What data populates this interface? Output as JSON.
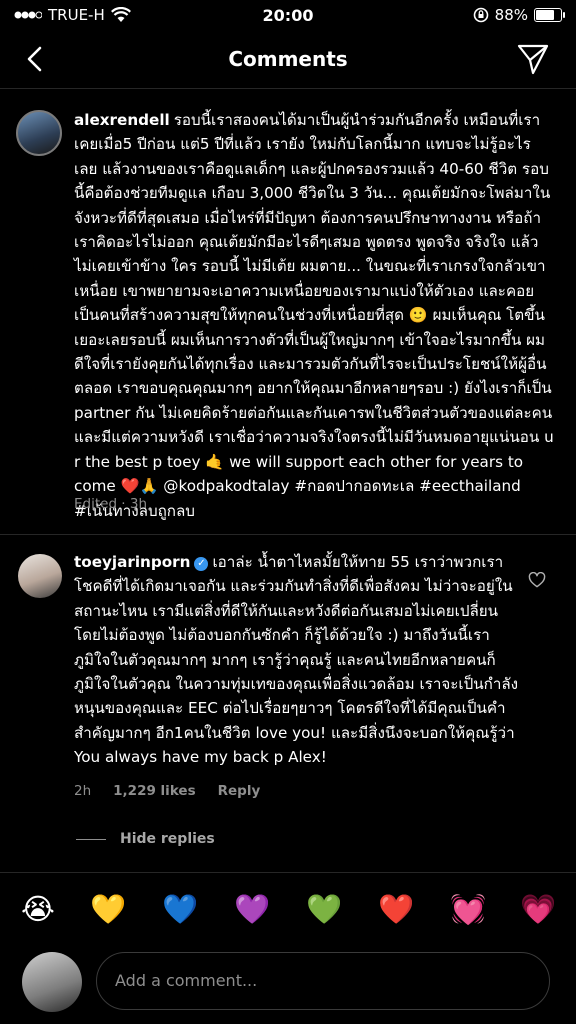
{
  "status_bar": {
    "carrier": "TRUE-H",
    "time": "20:00",
    "battery": "88%",
    "battery_level": 0.88
  },
  "nav": {
    "title": "Comments"
  },
  "caption": {
    "username": "alexrendell",
    "text": "รอบนี้เราสองคนได้มาเป็นผู้นำร่วมกันอีกครั้ง เหมือนที่เราเคยเมื่อ5 ปีก่อน แต่5 ปีที่แล้ว เรายัง ใหม่กับโลกนี้มาก แทบจะไม่รู้อะไรเลย แล้วงานของเราคือดูแลเด็กๆ และผู้ปกครองรวมแล้ว 40-60 ชีวิต รอบนี้คือต้องช่วยทีมดูแล เกือบ 3,000 ชีวิตใน 3 วัน... คุณเต้ยมักจะโพล่มาในจังหวะที่ดีที่สุดเสมอ เมื่อไหร่ที่มีปัญหา ต้องการคนปรึกษาทางงาน หรือถ้าเราคิดอะไรไม่ออก คุณเต้ยมักมีอะไรดีๆเสมอ พูดตรง พูดจริง จริงใจ แล้วไม่เคยเข้าข้าง ใคร รอบนี้ ไม่มีเต้ย ผมตาย... ในขณะที่เราเกรงใจกลัวเขาเหนื่อย เขาพยายามจะเอาความเหนื่อยของเรามาแบ่งให้ตัวเอง และคอยเป็นคนที่สร้างความสุขให้ทุกคนในช่วงที่เหนื่อยที่สุด 🙂 ผมเห็นคุณ โตขึ้นเยอะเลยรอบนี้ ผมเห็นการวางตัวที่เป็นผู้ใหญ่มากๆ เข้าใจอะไรมากขึ้น ผมดีใจที่เรายังคุยกันได้ทุกเรื่อง และมารวมตัวกันที่ไรจะเป็นประโยชน์ให้ผู้อื่นตลอด เราขอบคุณคุณมากๆ อยากให้คุณมาอีกหลายๆรอบ :) ยังไงเราก็เป็น partner กัน ไม่เคยคิดร้ายต่อกันและกันเคารพในชีวิตส่วนตัวของแต่ละคน และมีแต่ความหวังดี เราเชื่อว่าความจริงใจตรงนี้ไม่มีวันหมดอายุแน่นอน u r the best p toey 🤙 we will support each other for years to come ❤️🙏 @kodpakodtalay #กอดปากอดทะเล #eecthailand #เน้นทางลบถูกลบ",
    "meta": "Edited · 3h"
  },
  "comment": {
    "username": "toeyjarinporn",
    "text": "เอาล่ะ น้ำตาไหลมั้ยให้ทาย 55 เราว่าพวกเราโชคดีที่ได้เกิดมาเจอกัน และร่วมกันทำสิ่งที่ดีเพื่อสังคม ไม่ว่าจะอยู่ในสถานะไหน เรามีแต่สิ่งที่ดีให้กันและหวังดีต่อกันเสมอไม่เคยเปลี่ยน โดยไม่ต้องพูด ไม่ต้องบอกกันซักคำ ก็รู้ได้ด้วยใจ :) มาถึงวันนี้เราภูมิใจในตัวคุณมากๆ มากๆ เรารู้ว่าคุณรู้ และคนไทยอีกหลายคนก็ภูมิใจในตัวคุณ ในความทุ่มเทของคุณเพื่อสิ่งแวดล้อม เราจะเป็นกำลังหนุนของคุณและ EEC ต่อไปเรื่อยๆยาวๆ โคตรดีใจที่ได้มีคุณเป็นคำสำคัญมากๆ อีก1คนในชีวิต love you! และมีสิ่งนึงจะบอกให้คุณรู้ว่า You always have my back p Alex!",
    "time": "2h",
    "likes": "1,229 likes",
    "reply": "Reply",
    "hide_replies": "Hide replies"
  },
  "emoji_bar": [
    "😭",
    "💛",
    "💙",
    "💜",
    "💚",
    "❤️",
    "💓",
    "💗"
  ],
  "compose": {
    "placeholder": "Add a comment..."
  }
}
